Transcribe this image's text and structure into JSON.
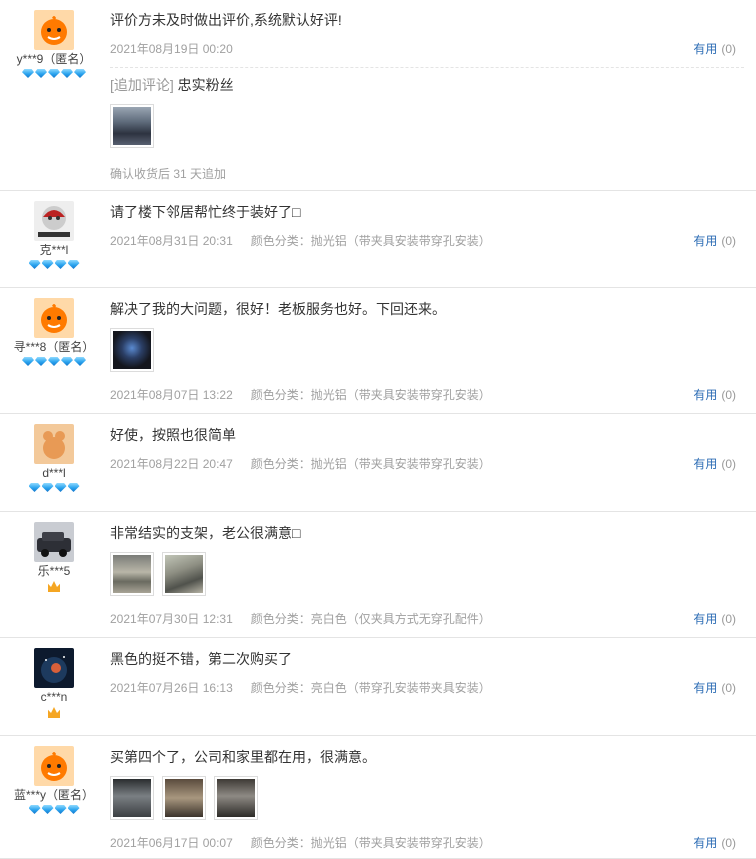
{
  "useful_label": "有用",
  "reviews": [
    {
      "user": "y***9（匿名）",
      "text": "评价方未及时做出评价,系统默认好评!",
      "date": "2021年08月19日 00:20",
      "sku": "",
      "useful": "(0)",
      "append": {
        "label": "[追加评论]",
        "text": "忠实粉丝",
        "footer": "确认收货后 31 天追加"
      }
    },
    {
      "user": "克***l",
      "text": "请了楼下邻居帮忙终于装好了□",
      "date": "2021年08月31日 20:31",
      "sku": "颜色分类：抛光铝（带夹具安装带穿孔安装）",
      "useful": "(0)"
    },
    {
      "user": "寻***8（匿名）",
      "text": "解决了我的大问题，很好！老板服务也好。下回还来。",
      "date": "2021年08月07日 13:22",
      "sku": "颜色分类：抛光铝（带夹具安装带穿孔安装）",
      "useful": "(0)"
    },
    {
      "user": "d***l",
      "text": "好使，按照也很简单",
      "date": "2021年08月22日 20:47",
      "sku": "颜色分类：抛光铝（带夹具安装带穿孔安装）",
      "useful": "(0)"
    },
    {
      "user": "乐***5",
      "text": "非常结实的支架，老公很满意□",
      "date": "2021年07月30日 12:31",
      "sku": "颜色分类：亮白色（仅夹具方式无穿孔配件）",
      "useful": "(0)"
    },
    {
      "user": "c***n",
      "text": "黑色的挺不错，第二次购买了",
      "date": "2021年07月26日 16:13",
      "sku": "颜色分类：亮白色（带穿孔安装带夹具安装）",
      "useful": "(0)"
    },
    {
      "user": "蓝***y（匿名）",
      "text": "买第四个了，公司和家里都在用，很满意。",
      "date": "2021年06月17日 00:07",
      "sku": "颜色分类：抛光铝（带夹具安装带穿孔安装）",
      "useful": "(0)"
    }
  ]
}
